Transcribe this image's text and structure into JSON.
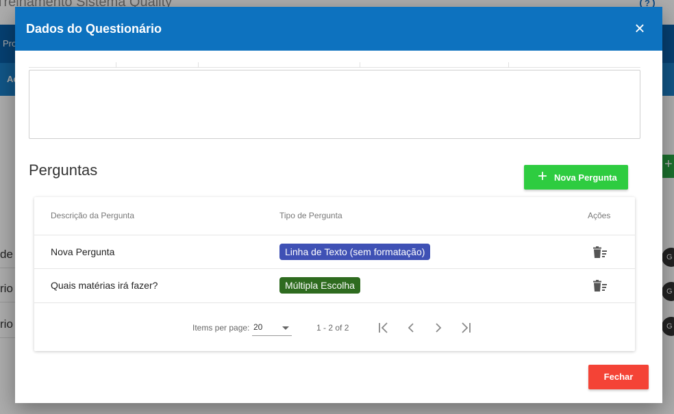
{
  "background": {
    "app_title": "Treinamento Sistema Quality",
    "help_icon": "?",
    "bar1_text": "Pro",
    "bar2_text": "Ac",
    "row_fragments": [
      "de",
      "rio",
      "rio"
    ],
    "chip_letters": [
      "G",
      "G",
      "G"
    ],
    "green_button_icon": "+"
  },
  "dialog": {
    "title": "Dados do Questionário",
    "close_icon": "×",
    "section_title": "Perguntas",
    "new_question_button": {
      "icon": "+",
      "label": "Nova Pergunta",
      "color": "#2ecc40"
    },
    "table": {
      "headers": [
        "Descrição da Pergunta",
        "Tipo de Pergunta",
        "Ações"
      ],
      "rows": [
        {
          "description": "Nova Pergunta",
          "type": "Linha de Texto (sem formatação)",
          "type_color": "#3f51b5"
        },
        {
          "description": "Quais matérias irá fazer?",
          "type": "Múltipla Escolha",
          "type_color": "#2e6b1f"
        }
      ]
    },
    "paginator": {
      "items_per_page_label": "Items per page:",
      "page_size": "20",
      "range_label": "1 - 2 of 2"
    },
    "close_button": {
      "label": "Fechar",
      "color": "#f44336"
    }
  },
  "colors": {
    "header": "#0d72bf"
  }
}
